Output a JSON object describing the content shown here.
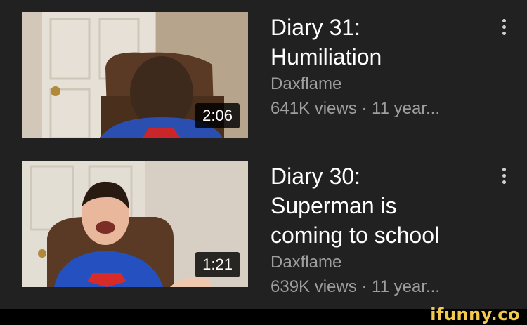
{
  "videos": [
    {
      "title_lines": [
        "Diary 31:",
        "Humiliation"
      ],
      "channel": "Daxflame",
      "stats": "641K views · 11 year...",
      "duration": "2:06"
    },
    {
      "title_lines": [
        "Diary 30:",
        "Superman is",
        "coming to school"
      ],
      "channel": "Daxflame",
      "stats": "639K views · 11 year...",
      "duration": "1:21"
    }
  ],
  "watermark": "ifunny.co"
}
